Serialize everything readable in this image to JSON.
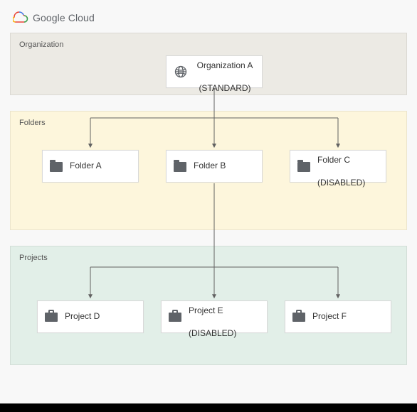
{
  "header": {
    "brand_word1": "Google",
    "brand_word2": "Cloud"
  },
  "zones": {
    "org_label": "Organization",
    "folders_label": "Folders",
    "projects_label": "Projects"
  },
  "org": {
    "line1": "Organization A",
    "line2": "(STANDARD)"
  },
  "folders": {
    "a": {
      "label": "Folder A"
    },
    "b": {
      "label": "Folder B"
    },
    "c": {
      "line1": "Folder C",
      "line2": "(DISABLED)"
    }
  },
  "projects": {
    "d": {
      "label": "Project D"
    },
    "e": {
      "line1": "Project E",
      "line2": "(DISABLED)"
    },
    "f": {
      "label": "Project F"
    }
  },
  "icons": {
    "globe": "globe-icon",
    "folder": "folder-icon",
    "briefcase": "briefcase-icon",
    "cloud_logo": "google-cloud-logo"
  },
  "colors": {
    "zone_org": "#eceae4",
    "zone_folders": "#fdf6dc",
    "zone_projects": "#e2efe8",
    "connector": "#616161"
  }
}
